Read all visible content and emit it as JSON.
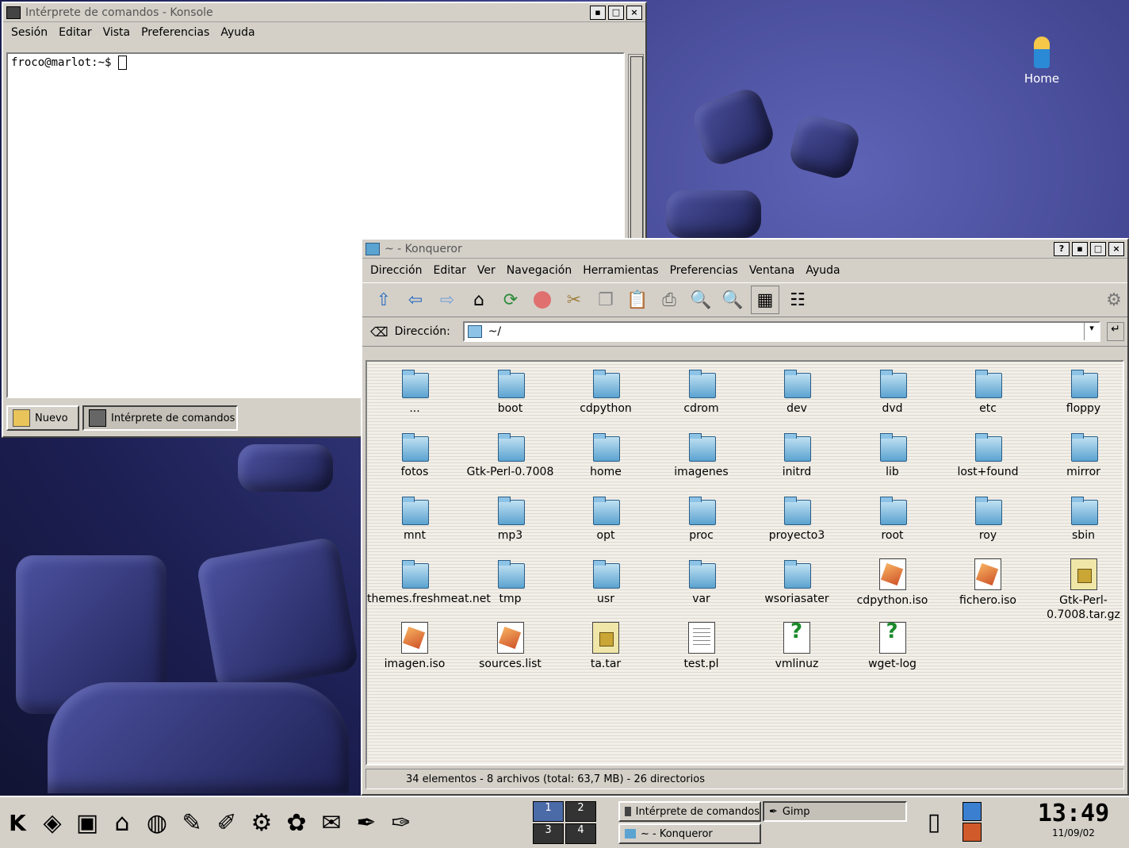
{
  "desktop": {
    "home_icon_label": "Home"
  },
  "konsole": {
    "title": "Intérprete de comandos - Konsole",
    "menu": [
      "Sesión",
      "Editar",
      "Vista",
      "Preferencias",
      "Ayuda"
    ],
    "prompt": "froco@marlot:~$",
    "tabs": [
      {
        "label": "Nuevo"
      },
      {
        "label": "Intérprete de comandos"
      }
    ]
  },
  "konqueror": {
    "title": "~ - Konqueror",
    "menu": [
      "Dirección",
      "Editar",
      "Ver",
      "Navegación",
      "Herramientas",
      "Preferencias",
      "Ventana",
      "Ayuda"
    ],
    "location_label": "Dirección:",
    "location_value": "~/",
    "status": "34 elementos - 8 archivos (total: 63,7 MB) - 26 directorios",
    "items": [
      {
        "label": "...",
        "kind": "folder"
      },
      {
        "label": "boot",
        "kind": "folder"
      },
      {
        "label": "cdpython",
        "kind": "folder"
      },
      {
        "label": "cdrom",
        "kind": "folder"
      },
      {
        "label": "dev",
        "kind": "folder"
      },
      {
        "label": "dvd",
        "kind": "folder"
      },
      {
        "label": "etc",
        "kind": "folder"
      },
      {
        "label": "floppy",
        "kind": "folder"
      },
      {
        "label": "fotos",
        "kind": "folder"
      },
      {
        "label": "Gtk-Perl-0.7008",
        "kind": "folder"
      },
      {
        "label": "home",
        "kind": "folder"
      },
      {
        "label": "imagenes",
        "kind": "folder"
      },
      {
        "label": "initrd",
        "kind": "folder"
      },
      {
        "label": "lib",
        "kind": "folder"
      },
      {
        "label": "lost+found",
        "kind": "folder-locked"
      },
      {
        "label": "mirror",
        "kind": "folder"
      },
      {
        "label": "mnt",
        "kind": "folder"
      },
      {
        "label": "mp3",
        "kind": "folder"
      },
      {
        "label": "opt",
        "kind": "folder"
      },
      {
        "label": "proc",
        "kind": "folder"
      },
      {
        "label": "proyecto3",
        "kind": "folder"
      },
      {
        "label": "root",
        "kind": "folder"
      },
      {
        "label": "roy",
        "kind": "folder"
      },
      {
        "label": "sbin",
        "kind": "folder"
      },
      {
        "label": "themes.freshmeat.net",
        "kind": "folder"
      },
      {
        "label": "tmp",
        "kind": "folder"
      },
      {
        "label": "usr",
        "kind": "folder"
      },
      {
        "label": "var",
        "kind": "folder"
      },
      {
        "label": "wsoriasater",
        "kind": "folder"
      },
      {
        "label": "cdpython.iso",
        "kind": "image"
      },
      {
        "label": "fichero.iso",
        "kind": "image"
      },
      {
        "label": "Gtk-Perl-0.7008.tar.gz",
        "kind": "archive"
      },
      {
        "label": "imagen.iso",
        "kind": "image"
      },
      {
        "label": "sources.list",
        "kind": "image"
      },
      {
        "label": "ta.tar",
        "kind": "archive"
      },
      {
        "label": "test.pl",
        "kind": "script"
      },
      {
        "label": "vmlinuz",
        "kind": "unknown"
      },
      {
        "label": "wget-log",
        "kind": "unknown"
      }
    ]
  },
  "taskbar": {
    "pager": [
      "1",
      "2",
      "3",
      "4"
    ],
    "tasks": [
      {
        "label": "Intérprete de comandos"
      },
      {
        "label": "Gimp"
      },
      {
        "label": "~ - Konqueror"
      }
    ],
    "clock_time": "13:49",
    "clock_date": "11/09/02"
  },
  "colors": {
    "window_bg": "#d4d0c8",
    "desktop": "#3a3e86"
  }
}
